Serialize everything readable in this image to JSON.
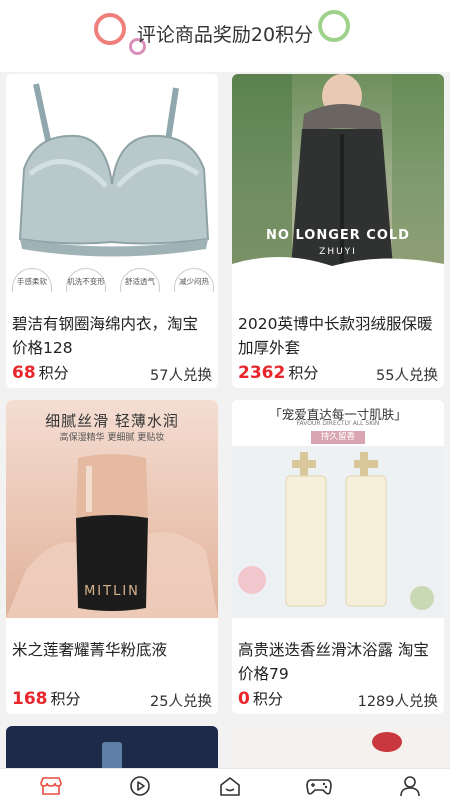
{
  "header": {
    "title": "评论商品奖励20积分"
  },
  "points_unit": "积分",
  "products": [
    {
      "name": "碧洁有钢圈海绵内衣，淘宝价格128",
      "points": "68",
      "redeemed": "57人兑换",
      "features": [
        "手感柔软",
        "机洗不变形",
        "舒适透气",
        "减少闷热"
      ]
    },
    {
      "name": "2020英博中长款羽绒服保暖加厚外套",
      "points": "2362",
      "redeemed": "55人兑换",
      "banner_text": "NO LONGER COLD",
      "banner_sub": "ZHUYI"
    },
    {
      "name": "米之莲奢耀菁华粉底液",
      "points": "168",
      "redeemed": "25人兑换",
      "headline": "细腻丝滑 轻薄水润",
      "subline": "高保湿精华 更细腻 更贴妆",
      "bottle_brand": "MITLIN"
    },
    {
      "name": "高贵迷迭香丝滑沐浴露 淘宝价格79",
      "points": "0",
      "redeemed": "1289人兑换",
      "headline": "「宠爱直达每一寸肌肤」",
      "subline": "FAVOUR DIRECTLY ALL SKIN",
      "badge": "持久留香"
    }
  ],
  "nav": {
    "items": [
      {
        "icon": "store-icon",
        "active": true
      },
      {
        "icon": "play-icon",
        "active": false
      },
      {
        "icon": "home-icon",
        "active": false
      },
      {
        "icon": "gamepad-icon",
        "active": false
      },
      {
        "icon": "user-icon",
        "active": false
      }
    ],
    "active_color": "#e84c3d"
  },
  "colors": {
    "price": "#e8262b",
    "accent": "#e84c3d"
  }
}
